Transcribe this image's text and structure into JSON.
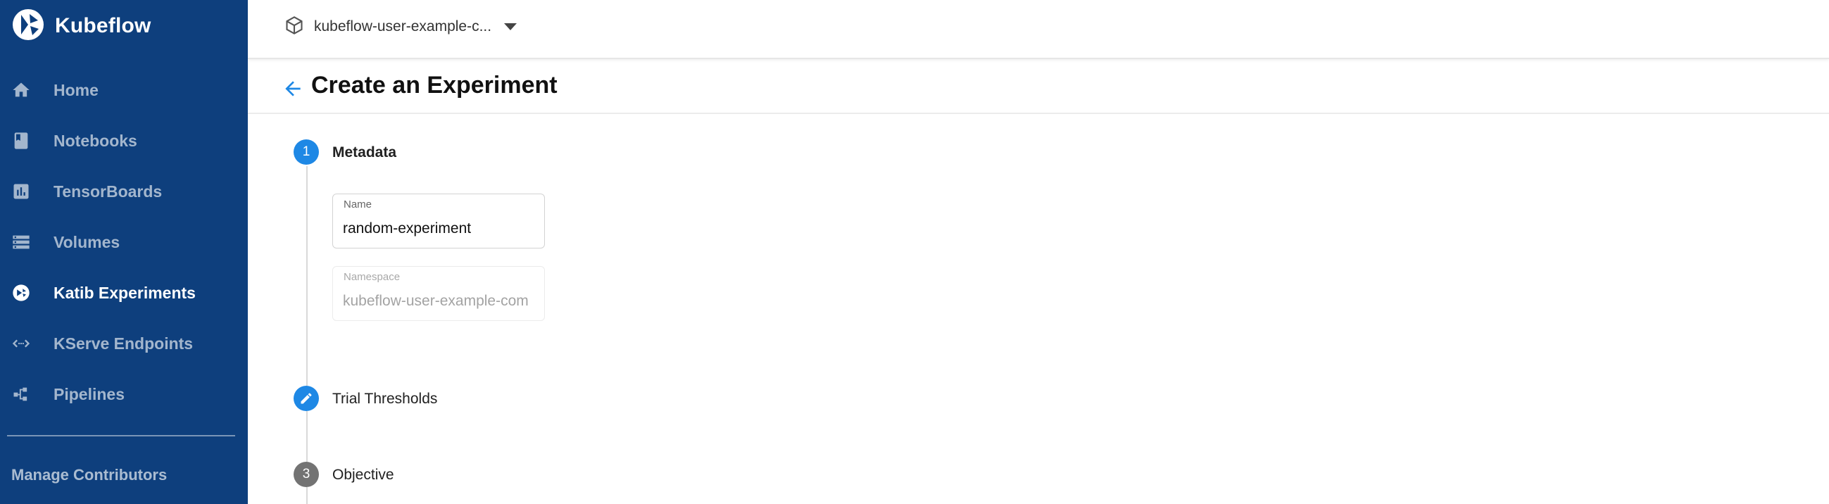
{
  "app": {
    "name": "Kubeflow"
  },
  "sidebar": {
    "items": [
      {
        "label": "Home",
        "icon": "home-icon",
        "active": false
      },
      {
        "label": "Notebooks",
        "icon": "book-icon",
        "active": false
      },
      {
        "label": "TensorBoards",
        "icon": "bar-chart-icon",
        "active": false
      },
      {
        "label": "Volumes",
        "icon": "storage-icon",
        "active": false
      },
      {
        "label": "Katib Experiments",
        "icon": "katib-icon",
        "active": true
      },
      {
        "label": "KServe Endpoints",
        "icon": "code-arrows-icon",
        "active": false
      },
      {
        "label": "Pipelines",
        "icon": "pipeline-icon",
        "active": false
      }
    ],
    "manage_label": "Manage Contributors"
  },
  "topbar": {
    "namespace": "kubeflow-user-example-c..."
  },
  "page": {
    "title": "Create an Experiment"
  },
  "stepper": {
    "steps": [
      {
        "number": "1",
        "label": "Metadata",
        "state": "active"
      },
      {
        "number": "",
        "label": "Trial Thresholds",
        "state": "editable"
      },
      {
        "number": "3",
        "label": "Objective",
        "state": "pending"
      }
    ]
  },
  "form": {
    "name": {
      "label": "Name",
      "value": "random-experiment"
    },
    "namespace": {
      "label": "Namespace",
      "value": "kubeflow-user-example-com"
    }
  },
  "colors": {
    "sidebar_bg": "#0e3f7d",
    "accent": "#1e88e5",
    "step_pending": "#737373"
  }
}
